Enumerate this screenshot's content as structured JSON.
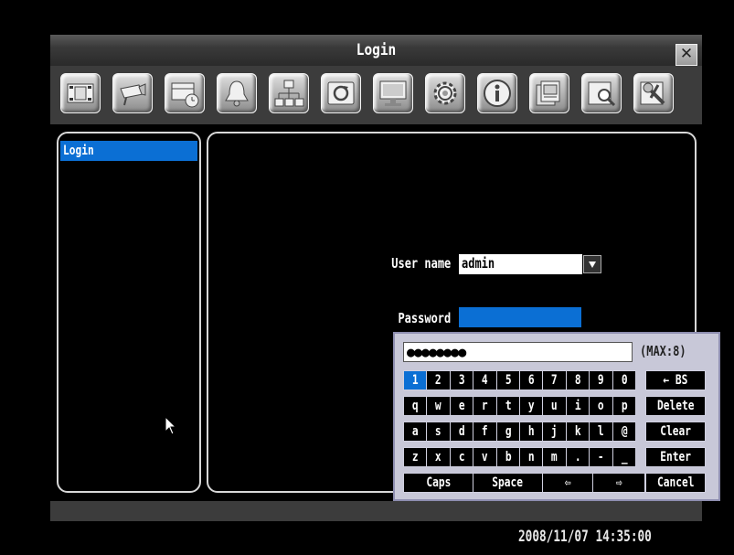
{
  "window": {
    "title": "Login",
    "close_label": "✕"
  },
  "toolbar": {
    "icons": [
      "record-icon",
      "camera-icon",
      "schedule-icon",
      "alarm-icon",
      "network-icon",
      "backup-icon",
      "display-icon",
      "settings-icon",
      "info-icon",
      "event-icon",
      "search-icon",
      "tools-icon"
    ]
  },
  "sidebar": {
    "items": [
      {
        "label": "Login",
        "selected": true
      }
    ]
  },
  "form": {
    "username_label": "User name",
    "username_value": "admin",
    "password_label": "Password"
  },
  "keyboard": {
    "input_value": "●●●●●●●●",
    "max_label": "(MAX:8)",
    "rows": [
      [
        "1",
        "2",
        "3",
        "4",
        "5",
        "6",
        "7",
        "8",
        "9",
        "0",
        "← BS"
      ],
      [
        "q",
        "w",
        "e",
        "r",
        "t",
        "y",
        "u",
        "i",
        "o",
        "p",
        "Delete"
      ],
      [
        "a",
        "s",
        "d",
        "f",
        "g",
        "h",
        "j",
        "k",
        "l",
        "@",
        "Clear"
      ],
      [
        "z",
        "x",
        "c",
        "v",
        "b",
        "n",
        "m",
        ".",
        "-",
        "_",
        "Enter"
      ],
      [
        "Caps",
        "Space",
        "⇦",
        "⇨",
        "Cancel"
      ]
    ]
  },
  "status": {
    "datetime": "2008/11/07  14:35:00"
  },
  "colors": {
    "selection": "#0b6fd4",
    "background": "#000000"
  }
}
